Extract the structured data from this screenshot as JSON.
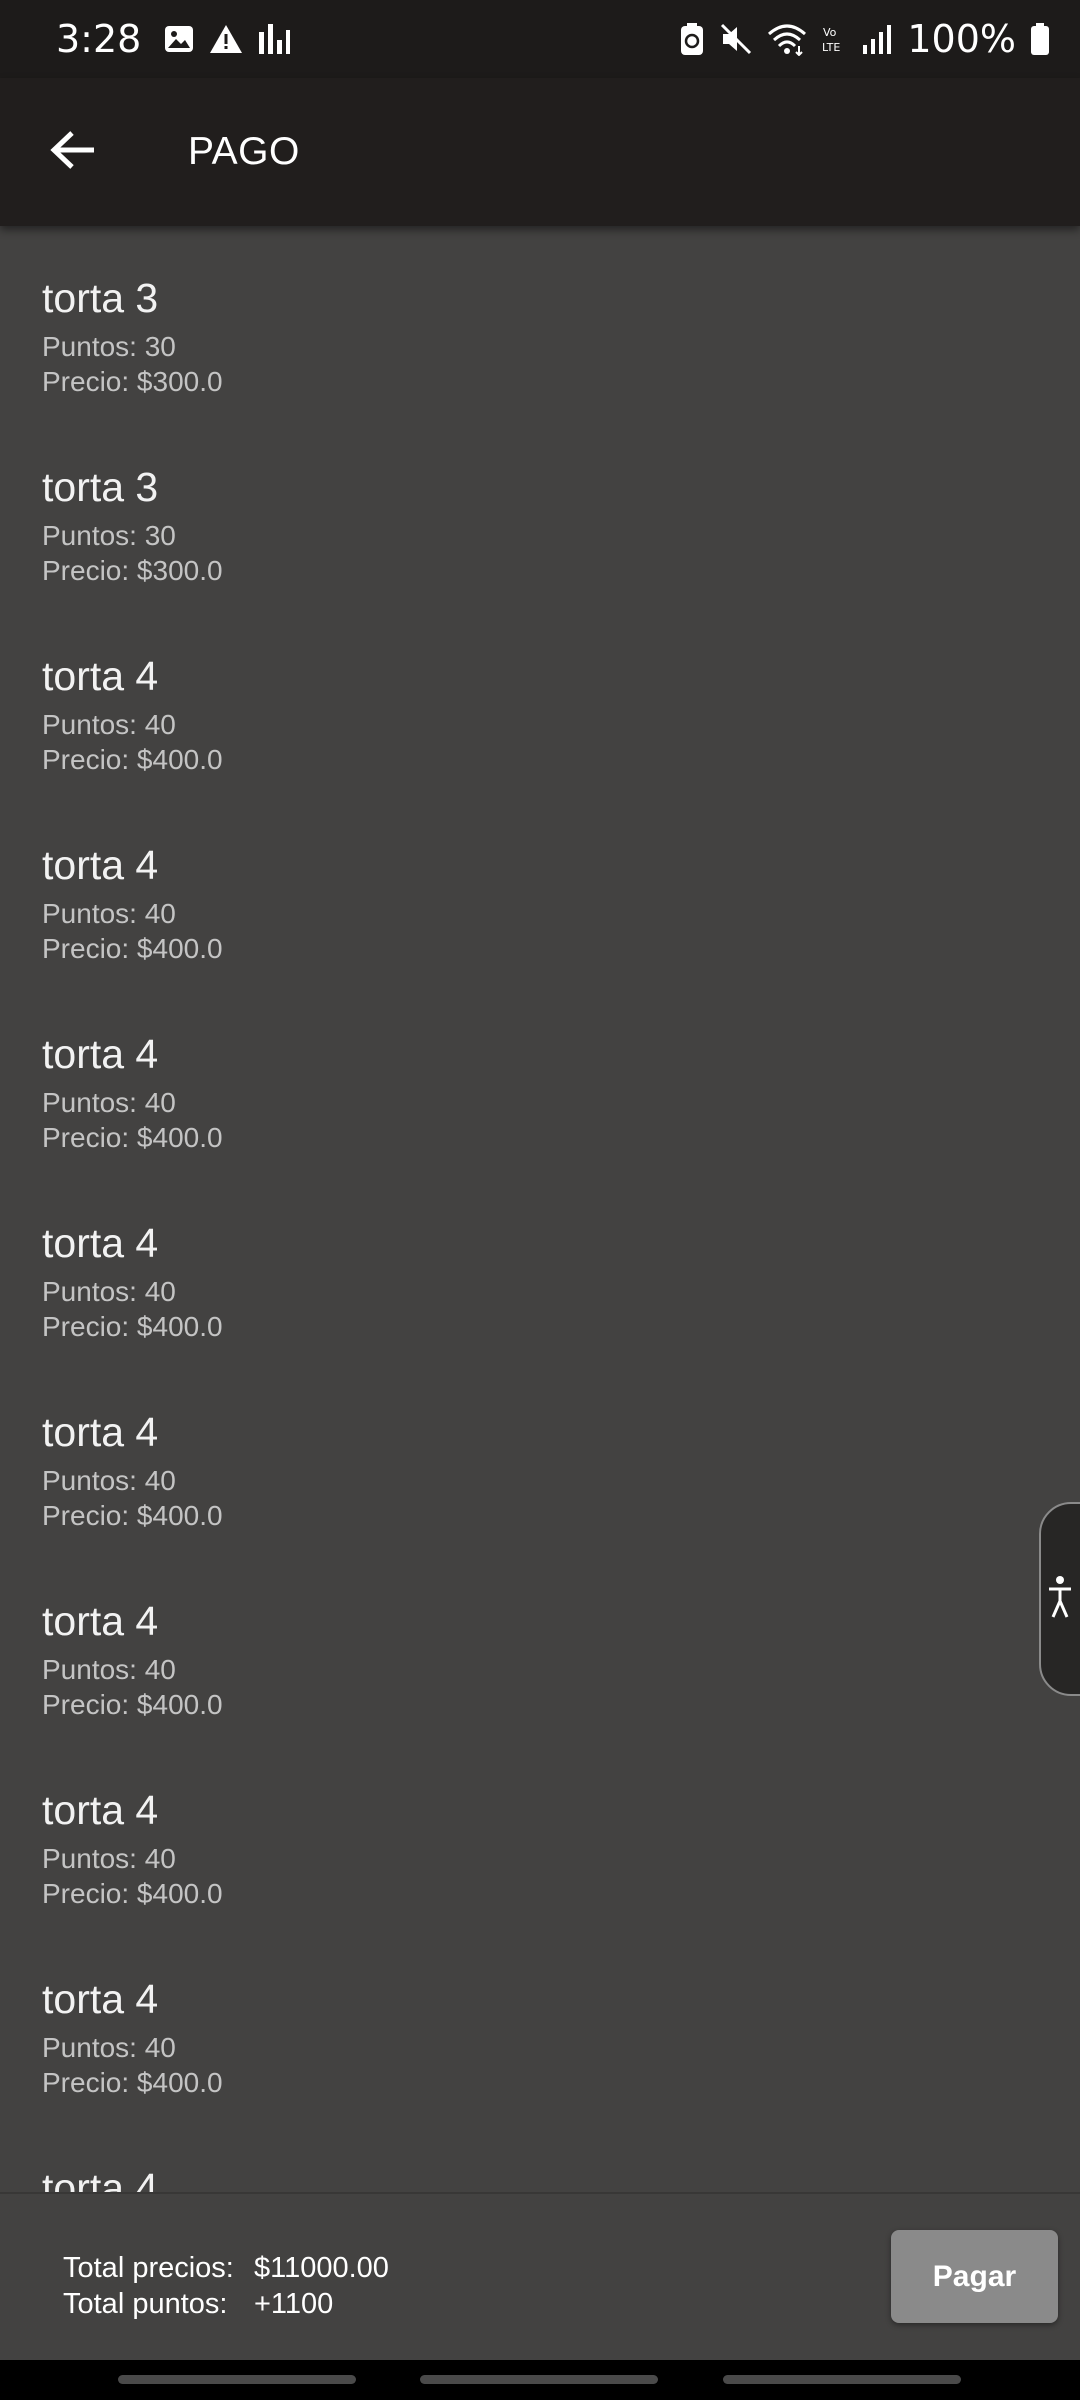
{
  "status_bar": {
    "time": "3:28",
    "battery_percent": "100%",
    "left_icons": [
      "image-icon",
      "warning-icon",
      "bars-chart-icon"
    ],
    "right_icons": [
      "battery-saver-icon",
      "mute-icon",
      "wifi-icon",
      "volte-icon",
      "signal-icon",
      "battery-icon"
    ],
    "volte_label": "Vo LTE"
  },
  "app_bar": {
    "title": "PAGO",
    "back_icon": "arrow-left-icon"
  },
  "items": [
    {
      "name": "torta 3",
      "points": "Puntos: 30",
      "price": "Precio: $300.0"
    },
    {
      "name": "torta 3",
      "points": "Puntos: 30",
      "price": "Precio: $300.0"
    },
    {
      "name": "torta 4",
      "points": "Puntos: 40",
      "price": "Precio: $400.0"
    },
    {
      "name": "torta 4",
      "points": "Puntos: 40",
      "price": "Precio: $400.0"
    },
    {
      "name": "torta 4",
      "points": "Puntos: 40",
      "price": "Precio: $400.0"
    },
    {
      "name": "torta 4",
      "points": "Puntos: 40",
      "price": "Precio: $400.0"
    },
    {
      "name": "torta 4",
      "points": "Puntos: 40",
      "price": "Precio: $400.0"
    },
    {
      "name": "torta 4",
      "points": "Puntos: 40",
      "price": "Precio: $400.0"
    },
    {
      "name": "torta 4",
      "points": "Puntos: 40",
      "price": "Precio: $400.0"
    },
    {
      "name": "torta 4",
      "points": "Puntos: 40",
      "price": "Precio: $400.0"
    },
    {
      "name": "torta 4",
      "points": "",
      "price": ""
    }
  ],
  "totals": {
    "prices_label": "Total precios:",
    "prices_value": "$11000.00",
    "points_label": "Total puntos:",
    "points_value": "+1100"
  },
  "pay_button": {
    "label": "Pagar"
  },
  "accessibility": {
    "icon": "accessibility-person-icon"
  }
}
